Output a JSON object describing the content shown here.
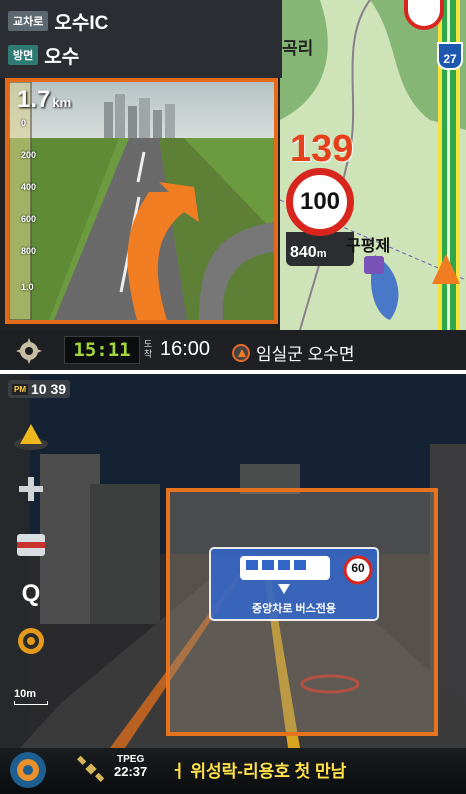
{
  "top_panel": {
    "junction_label": "교차로",
    "road_name": "오수IC",
    "direction_label": "방면",
    "direction_name": "오수",
    "distance_value": "1.7",
    "distance_unit": "km",
    "scale_ticks": [
      "0",
      "200",
      "400",
      "600",
      "800",
      "1.0"
    ],
    "map_place_1": "곡리",
    "map_place_2": "구평제",
    "highway_number": "27",
    "current_speed": "139",
    "speed_limit": "100",
    "camera_distance_value": "840",
    "camera_distance_unit": "m",
    "clock": "15:11",
    "arrival_label": "도착",
    "eta": "16:00",
    "destination": "임실군 오수면"
  },
  "bottom_panel": {
    "clock_ampm": "PM",
    "clock_time": "10 39",
    "side_buttons": [
      {
        "icon": "compass-icon",
        "label": ""
      },
      {
        "icon": "zoom-in-icon",
        "label": ""
      },
      {
        "icon": "route-icon",
        "label": ""
      },
      {
        "icon": "search-icon",
        "label": "Q"
      },
      {
        "icon": "map-icon",
        "label": ""
      }
    ],
    "scale_label": "10m",
    "sign_text": "중앙차로 버스전용",
    "sign_speed": "60",
    "tpeg_label": "TPEG",
    "tpeg_time": "22:37",
    "news_ticker": "ㅓ 위성락-리용호 첫 만남"
  },
  "colors": {
    "accent_orange": "#e7731f",
    "clock_green": "#a2d63c",
    "speed_red": "#d8261f",
    "ticker_yellow": "#ffe04a"
  }
}
